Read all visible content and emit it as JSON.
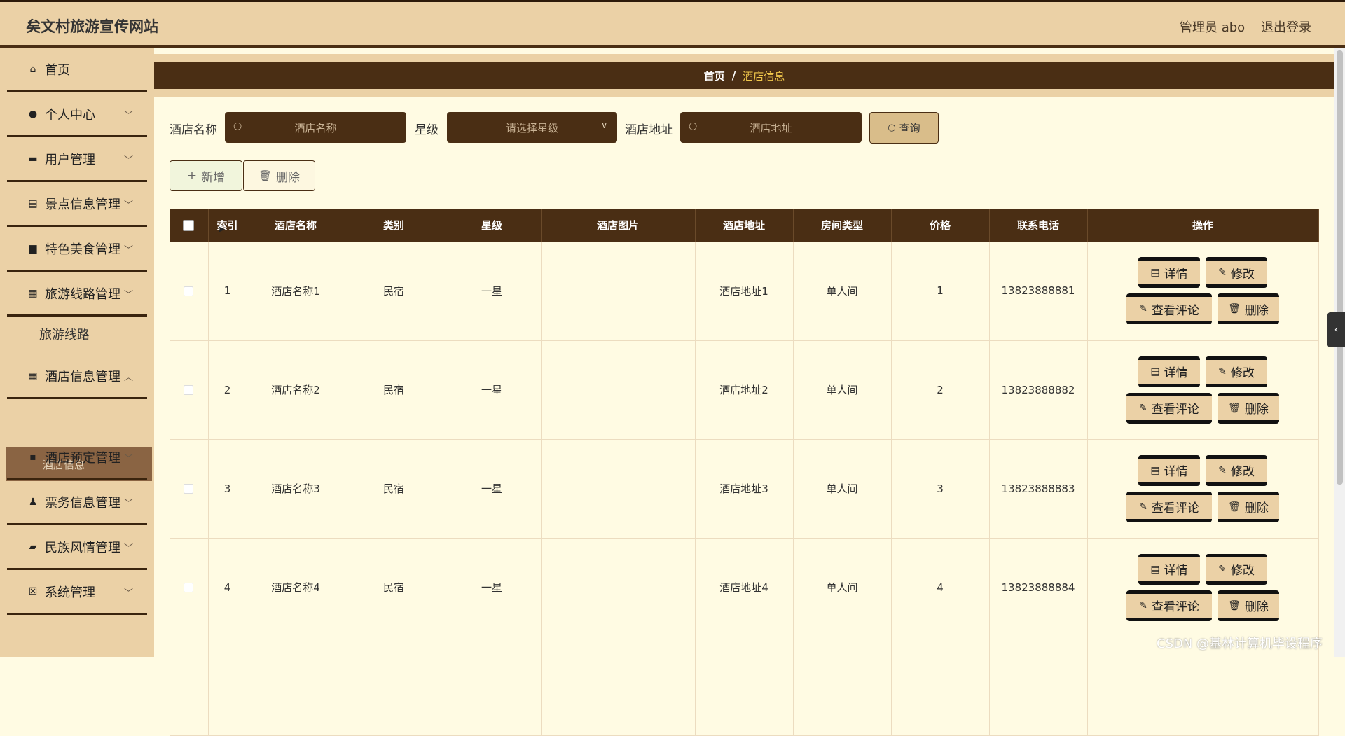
{
  "header": {
    "title": "矣文村旅游宣传网站",
    "user": "管理员 abo",
    "logout": "退出登录"
  },
  "sidebar": {
    "menus": [
      {
        "label": "首页"
      },
      {
        "label": "个人中心"
      },
      {
        "label": "用户管理"
      },
      {
        "label": "景点信息管理"
      },
      {
        "label": "特色美食管理"
      },
      {
        "label": "旅游线路管理"
      },
      {
        "label": "旅游线路"
      },
      {
        "label": "酒店信息管理"
      },
      {
        "label": "酒店信息"
      },
      {
        "label": "酒店预定管理"
      },
      {
        "label": "票务信息管理"
      },
      {
        "label": "民族风情管理"
      },
      {
        "label": "系统管理"
      }
    ]
  },
  "breadcrumb": {
    "home": "首页",
    "sep": "/",
    "current": "酒店信息"
  },
  "search": {
    "name_label": "酒店名称",
    "name_placeholder": "酒店名称",
    "star_label": "星级",
    "star_placeholder": "请选择星级",
    "addr_label": "酒店地址",
    "addr_placeholder": "酒店地址",
    "query": "查询"
  },
  "toolbar": {
    "add": "新增",
    "delete": "删除"
  },
  "table": {
    "headers": [
      "索引",
      "酒店名称",
      "类别",
      "星级",
      "酒店图片",
      "酒店地址",
      "房间类型",
      "价格",
      "联系电话",
      "操作"
    ],
    "rows": [
      {
        "index": "1",
        "name": "酒店名称1",
        "category": "民宿",
        "star": "一星",
        "image": "",
        "address": "酒店地址1",
        "room": "单人间",
        "price": "1",
        "phone": "13823888881"
      },
      {
        "index": "2",
        "name": "酒店名称2",
        "category": "民宿",
        "star": "一星",
        "image": "",
        "address": "酒店地址2",
        "room": "单人间",
        "price": "2",
        "phone": "13823888882"
      },
      {
        "index": "3",
        "name": "酒店名称3",
        "category": "民宿",
        "star": "一星",
        "image": "",
        "address": "酒店地址3",
        "room": "单人间",
        "price": "3",
        "phone": "13823888883"
      },
      {
        "index": "4",
        "name": "酒店名称4",
        "category": "民宿",
        "star": "一星",
        "image": "",
        "address": "酒店地址4",
        "room": "单人间",
        "price": "4",
        "phone": "13823888884"
      }
    ],
    "actions": {
      "detail": "详情",
      "edit": "修改",
      "comments": "查看评论",
      "delete": "删除"
    }
  },
  "watermark": "CSDN @基林计算机毕设程序",
  "colors": {
    "header_bg": "#ebd1a6",
    "dark_brown": "#4a2e14",
    "content_bg": "#fffbe3",
    "active_item": "#8a6443",
    "accent": "#f2c94c"
  }
}
